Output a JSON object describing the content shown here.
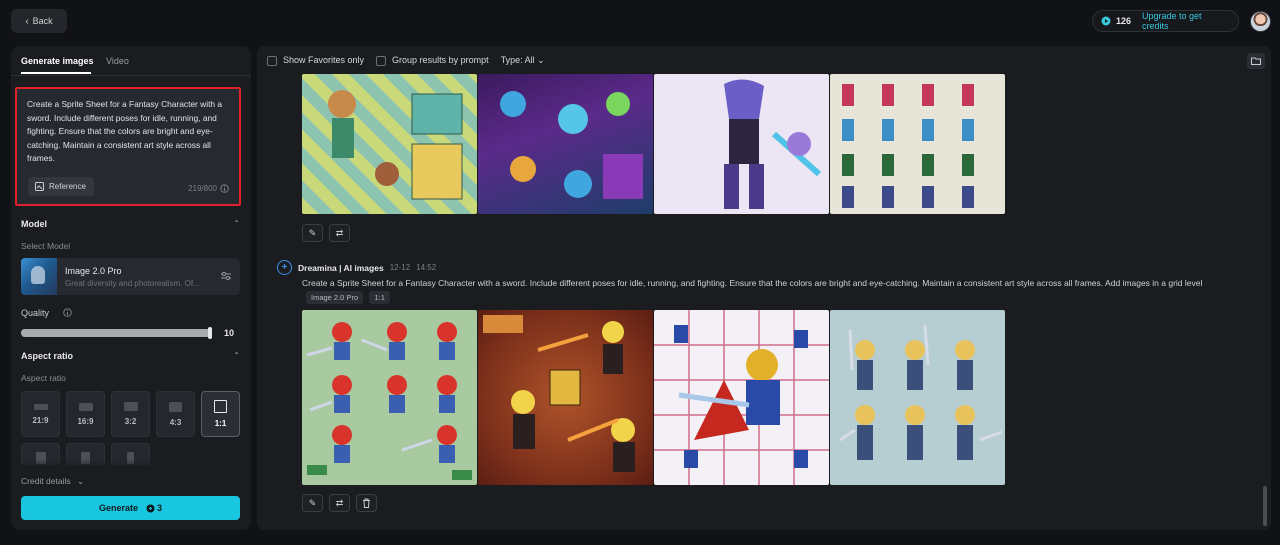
{
  "topbar": {
    "back_label": "Back",
    "credits": "126",
    "upgrade_label": "Upgrade to get credits"
  },
  "left": {
    "tabs": [
      "Generate images",
      "Video"
    ],
    "prompt": "Create a Sprite Sheet for a Fantasy Character with a sword. Include different poses for idle, running, and fighting. Ensure that the colors are bright and eye-catching. Maintain a consistent art style across all frames.",
    "reference_label": "Reference",
    "char_count": "219/800",
    "model_section": "Model",
    "select_model_label": "Select Model",
    "model_name": "Image 2.0 Pro",
    "model_desc": "Great diversity and photorealism. Of...",
    "quality_label": "Quality",
    "quality_value": "10",
    "quality_level": 1.0,
    "aspect_section": "Aspect ratio",
    "aspect_label": "Aspect ratio",
    "ratios": [
      "21:9",
      "16:9",
      "3:2",
      "4:3",
      "1:1"
    ],
    "selected_ratio": "1:1",
    "credit_details": "Credit details",
    "generate_label": "Generate",
    "generate_cost": "3"
  },
  "right": {
    "show_favorites": "Show Favorites only",
    "group_results": "Group results by prompt",
    "type_filter": "Type: All",
    "gen2": {
      "source": "Dreamina | AI images",
      "date": "12-12",
      "time": "14:52",
      "prompt": "Create a Sprite Sheet for a Fantasy Character with a sword. Include different poses for idle, running, and fighting. Ensure that the colors are bright and eye-catching. Maintain a consistent art style across all frames. Add images in a grid level",
      "model_tag": "Image 2.0 Pro",
      "ratio_tag": "1:1"
    }
  },
  "colors": {
    "accent": "#18c6e0",
    "highlight_border": "#e0202a",
    "link": "#37c8dd"
  }
}
